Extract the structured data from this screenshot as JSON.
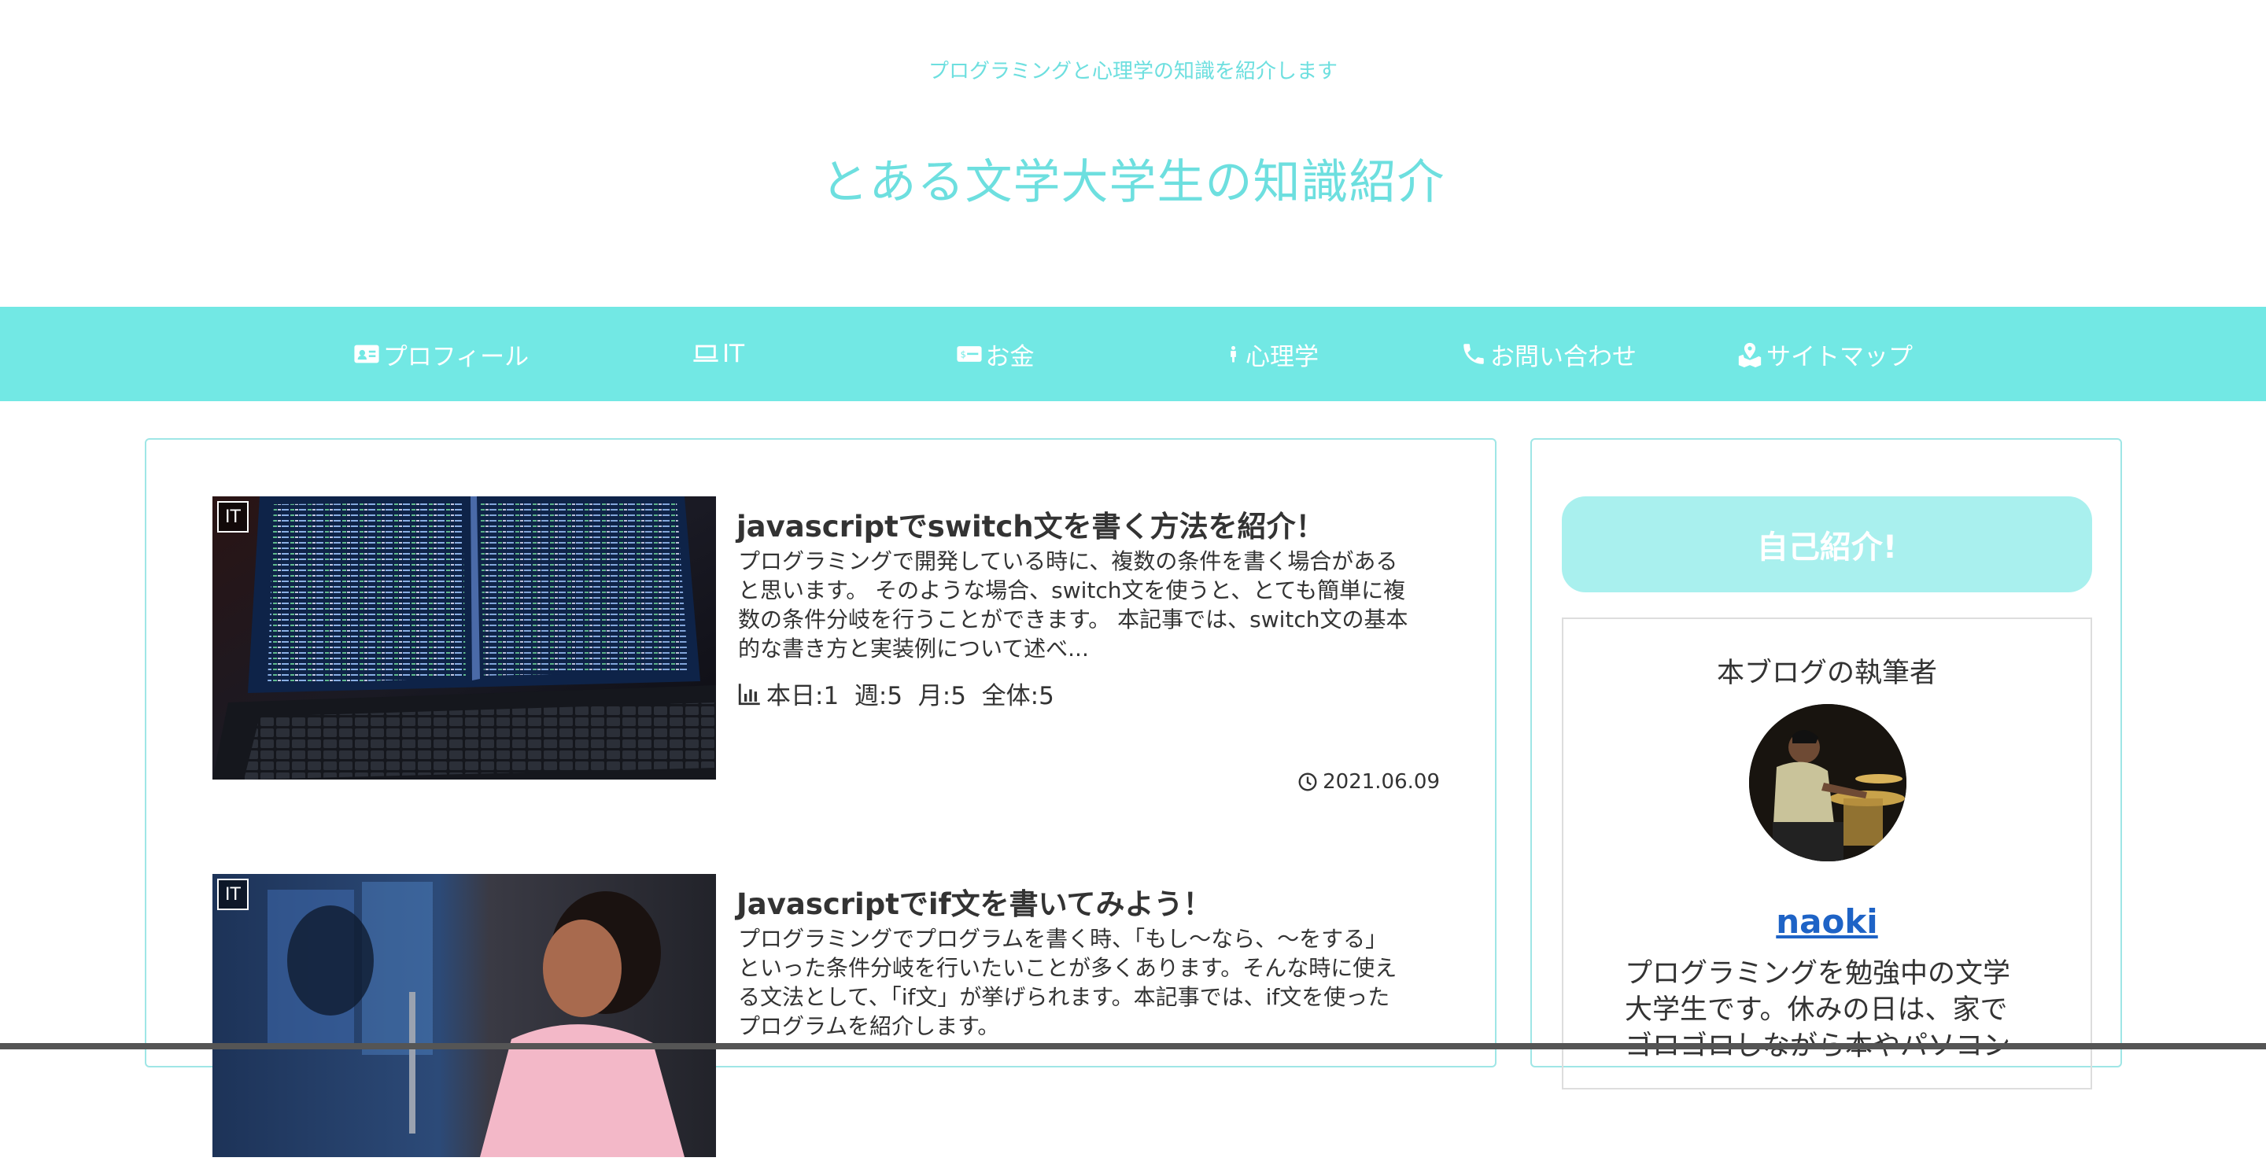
{
  "header": {
    "tagline": "プログラミングと心理学の知識を紹介します",
    "site_title": "とある文学大学生の知識紹介"
  },
  "nav": {
    "items": [
      {
        "label": "プロフィール",
        "icon": "id-card-icon"
      },
      {
        "label": "IT",
        "icon": "laptop-icon"
      },
      {
        "label": "お金",
        "icon": "money-icon"
      },
      {
        "label": "心理学",
        "icon": "person-icon"
      },
      {
        "label": "お問い合わせ",
        "icon": "phone-icon"
      },
      {
        "label": "サイトマップ",
        "icon": "map-icon"
      }
    ]
  },
  "posts": [
    {
      "category": "IT",
      "title": "javascriptでswitch文を書く方法を紹介！",
      "excerpt_lines": [
        "プログラミングで開発している時に、複数の条件を書く場合がある",
        "と思います。 そのような場合、switch文を使うと、とても簡単に複",
        "数の条件分岐を行うことができます。 本記事では、switch文の基本",
        "的な書き方と実装例について述べ..."
      ],
      "stats": "本日:1  週:5  月:5  全体:5",
      "date": "2021.06.09"
    },
    {
      "category": "IT",
      "title": "Javascriptでif文を書いてみよう！",
      "excerpt_lines": [
        "プログラミングでプログラムを書く時、「もし〜なら、〜をする」",
        "といった条件分岐を行いたいことが多くあります。そんな時に使え",
        "る文法として、「if文」が挙げられます。本記事では、if文を使った",
        "プログラムを紹介します。"
      ]
    }
  ],
  "sidebar": {
    "intro_button": "自己紹介!",
    "profile_heading": "本ブログの執筆者",
    "author_name": "naoki",
    "bio_lines": [
      "プログラミングを勉強中の文学",
      "大学生です。休みの日は、家で",
      "ゴロゴロしながら本やパソコン"
    ]
  },
  "colors": {
    "accent": "#72e8e4",
    "title": "#6ddfdf",
    "intro_button": "#a9f0ee",
    "link": "#1e63c6"
  }
}
